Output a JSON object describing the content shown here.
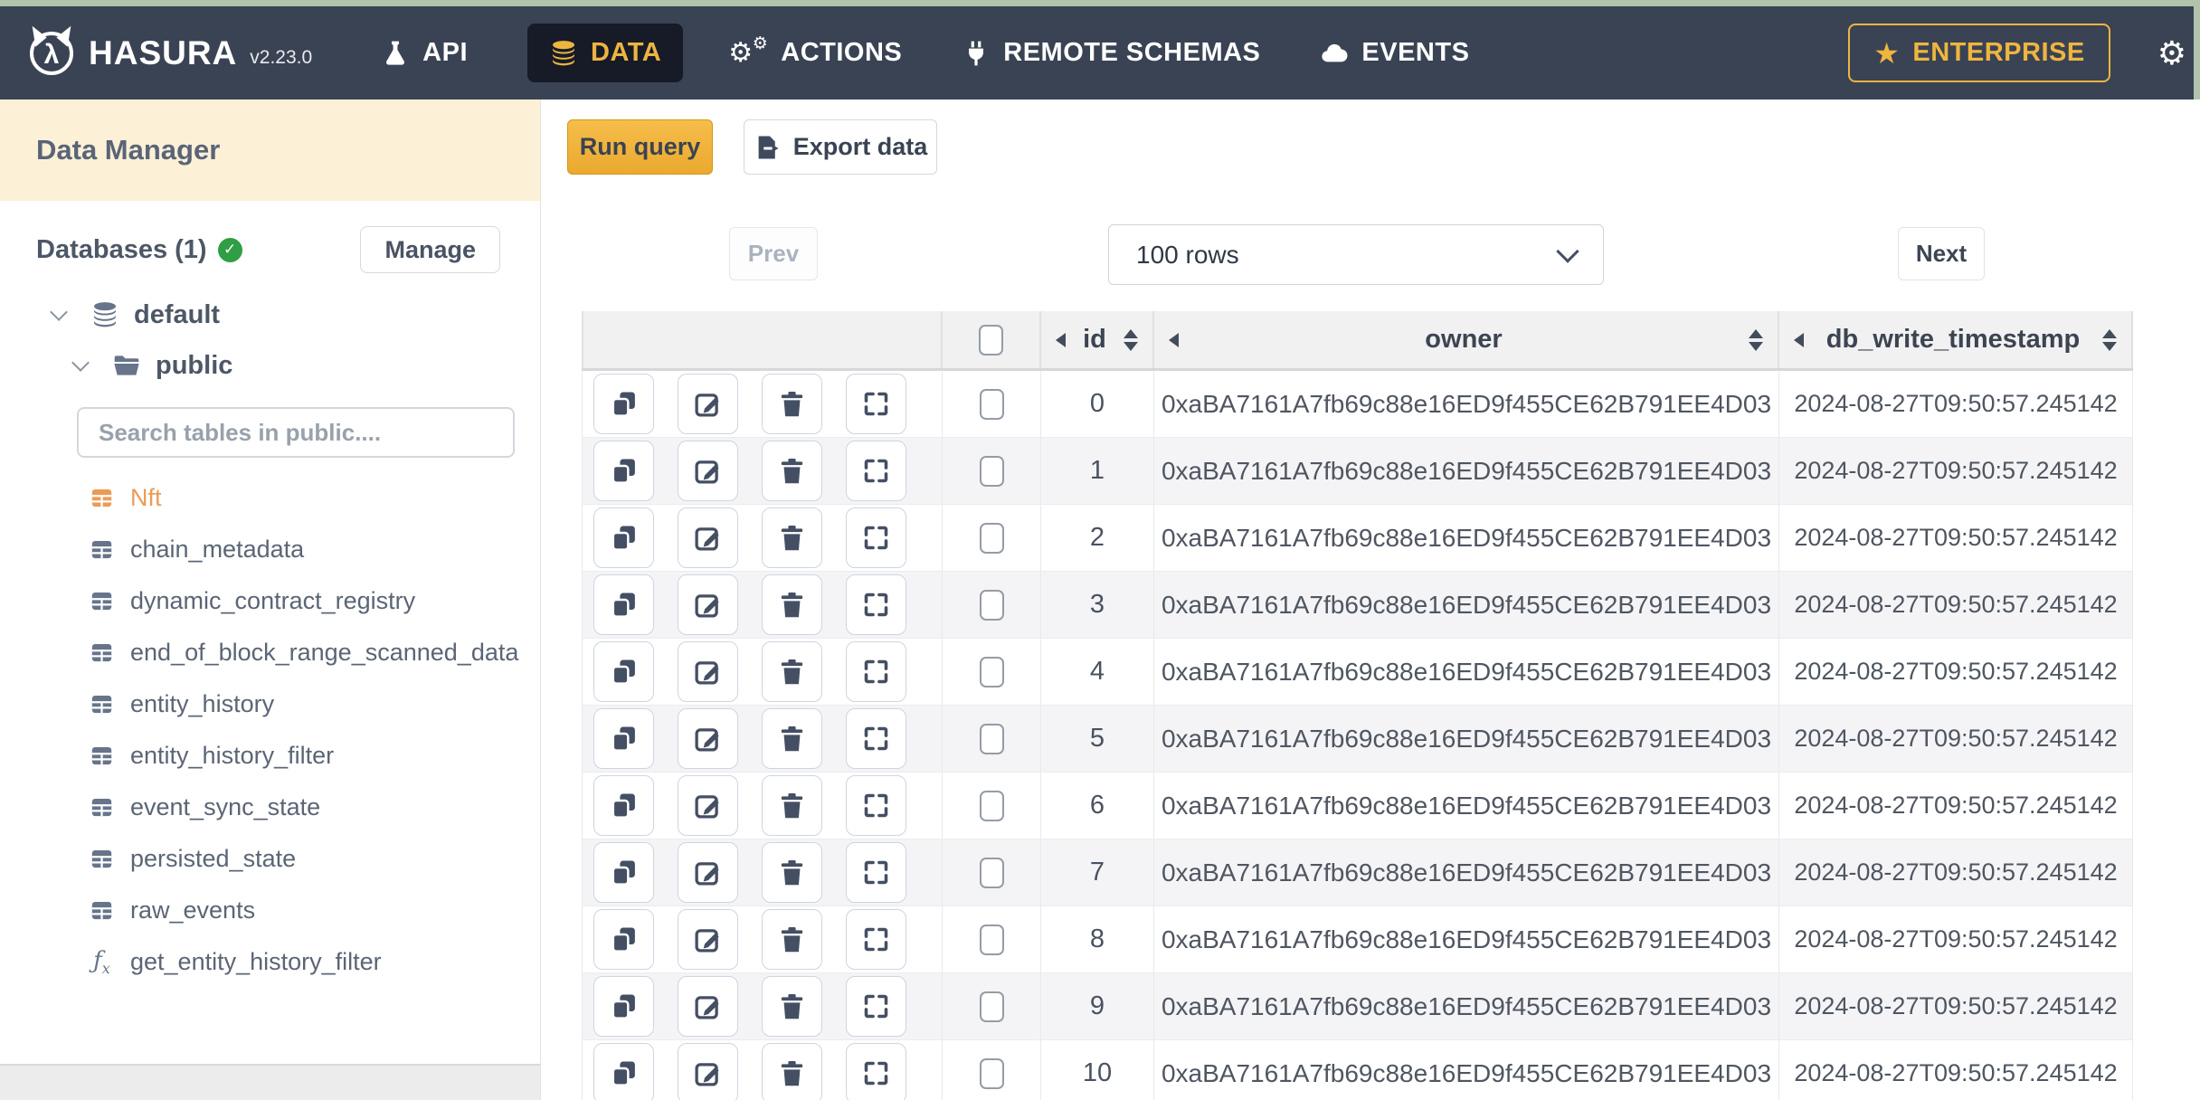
{
  "nav": {
    "brand": "HASURA",
    "version": "v2.23.0",
    "items": [
      {
        "label": "API",
        "icon": "flask-icon",
        "active": false
      },
      {
        "label": "DATA",
        "icon": "database-icon",
        "active": true
      },
      {
        "label": "ACTIONS",
        "icon": "gears-icon",
        "active": false
      },
      {
        "label": "REMOTE SCHEMAS",
        "icon": "plug-icon",
        "active": false
      },
      {
        "label": "EVENTS",
        "icon": "cloud-icon",
        "active": false
      }
    ],
    "enterprise_label": "ENTERPRISE"
  },
  "sidebar": {
    "title": "Data Manager",
    "databases_label": "Databases (1)",
    "manage_label": "Manage",
    "tree": {
      "database": "default",
      "schema": "public"
    },
    "search_placeholder": "Search tables in public....",
    "tables": [
      {
        "name": "Nft",
        "type": "table",
        "active": true
      },
      {
        "name": "chain_metadata",
        "type": "table",
        "active": false
      },
      {
        "name": "dynamic_contract_registry",
        "type": "table",
        "active": false
      },
      {
        "name": "end_of_block_range_scanned_data",
        "type": "table",
        "active": false
      },
      {
        "name": "entity_history",
        "type": "table",
        "active": false
      },
      {
        "name": "entity_history_filter",
        "type": "table",
        "active": false
      },
      {
        "name": "event_sync_state",
        "type": "table",
        "active": false
      },
      {
        "name": "persisted_state",
        "type": "table",
        "active": false
      },
      {
        "name": "raw_events",
        "type": "table",
        "active": false
      },
      {
        "name": "get_entity_history_filter",
        "type": "function",
        "active": false
      }
    ]
  },
  "toolbar": {
    "run_query": "Run query",
    "export_data": "Export data"
  },
  "pagination": {
    "prev": "Prev",
    "rows_select": "100 rows",
    "next": "Next"
  },
  "table": {
    "columns": [
      "id",
      "owner",
      "db_write_timestamp"
    ],
    "row_actions": [
      "copy",
      "edit",
      "delete",
      "expand"
    ],
    "rows": [
      {
        "id": "0",
        "owner": "0xaBA7161A7fb69c88e16ED9f455CE62B791EE4D03",
        "db_write_timestamp": "2024-08-27T09:50:57.245142"
      },
      {
        "id": "1",
        "owner": "0xaBA7161A7fb69c88e16ED9f455CE62B791EE4D03",
        "db_write_timestamp": "2024-08-27T09:50:57.245142"
      },
      {
        "id": "2",
        "owner": "0xaBA7161A7fb69c88e16ED9f455CE62B791EE4D03",
        "db_write_timestamp": "2024-08-27T09:50:57.245142"
      },
      {
        "id": "3",
        "owner": "0xaBA7161A7fb69c88e16ED9f455CE62B791EE4D03",
        "db_write_timestamp": "2024-08-27T09:50:57.245142"
      },
      {
        "id": "4",
        "owner": "0xaBA7161A7fb69c88e16ED9f455CE62B791EE4D03",
        "db_write_timestamp": "2024-08-27T09:50:57.245142"
      },
      {
        "id": "5",
        "owner": "0xaBA7161A7fb69c88e16ED9f455CE62B791EE4D03",
        "db_write_timestamp": "2024-08-27T09:50:57.245142"
      },
      {
        "id": "6",
        "owner": "0xaBA7161A7fb69c88e16ED9f455CE62B791EE4D03",
        "db_write_timestamp": "2024-08-27T09:50:57.245142"
      },
      {
        "id": "7",
        "owner": "0xaBA7161A7fb69c88e16ED9f455CE62B791EE4D03",
        "db_write_timestamp": "2024-08-27T09:50:57.245142"
      },
      {
        "id": "8",
        "owner": "0xaBA7161A7fb69c88e16ED9f455CE62B791EE4D03",
        "db_write_timestamp": "2024-08-27T09:50:57.245142"
      },
      {
        "id": "9",
        "owner": "0xaBA7161A7fb69c88e16ED9f455CE62B791EE4D03",
        "db_write_timestamp": "2024-08-27T09:50:57.245142"
      },
      {
        "id": "10",
        "owner": "0xaBA7161A7fb69c88e16ED9f455CE62B791EE4D03",
        "db_write_timestamp": "2024-08-27T09:50:57.245142"
      }
    ]
  },
  "colors": {
    "nav_bg": "#3a4354",
    "nav_active_bg": "#161b27",
    "brand_amber": "#eeb440",
    "run_query_gold": "#f0b23c",
    "sidebar_header_beige": "#fcf0d6",
    "active_table_orange": "#ec9b57",
    "status_green": "#2f9e44",
    "desktop_green_edge": "#b2c3ab",
    "slate_text": "#4d5766"
  }
}
